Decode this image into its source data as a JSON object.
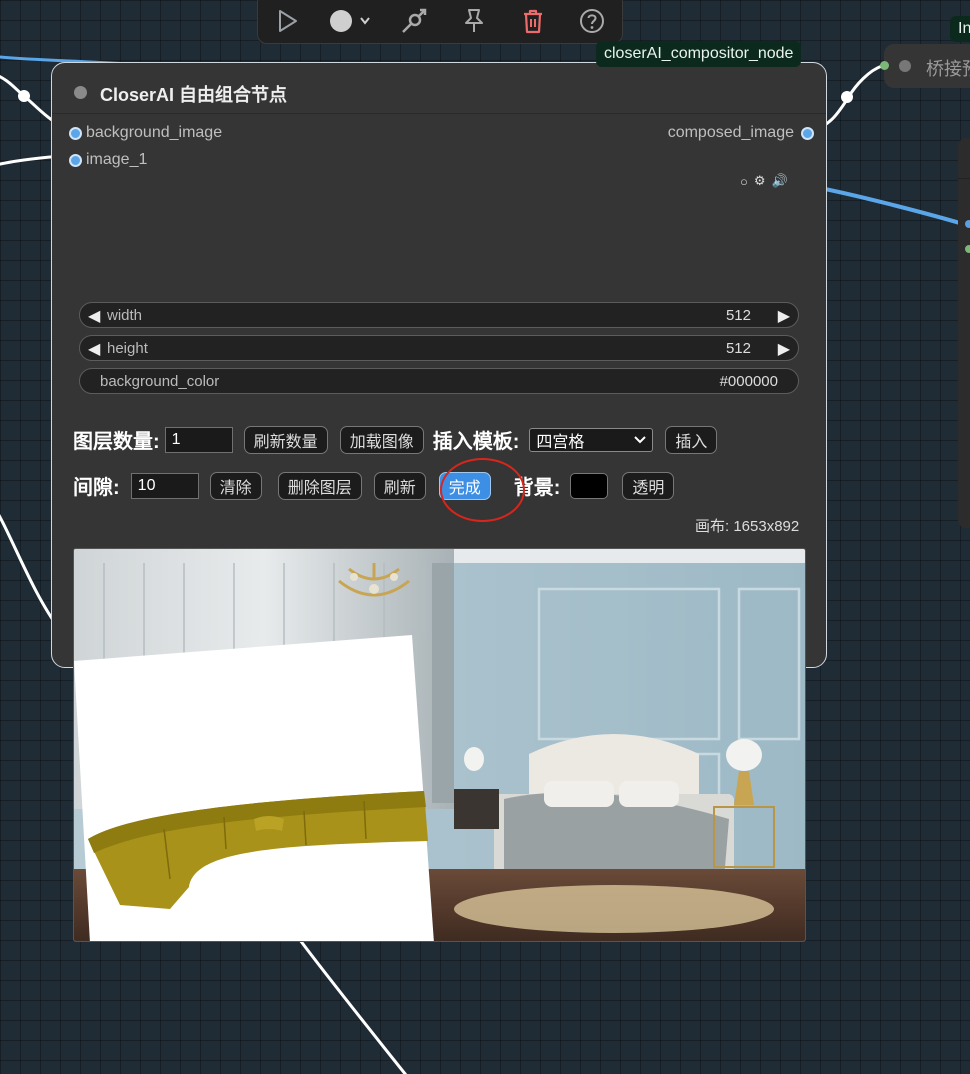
{
  "toolbar": {
    "buttons": [
      {
        "name": "run-icon"
      },
      {
        "name": "color-dot-icon"
      },
      {
        "name": "bypass-icon"
      },
      {
        "name": "pin-icon"
      },
      {
        "name": "delete-icon"
      },
      {
        "name": "help-icon"
      }
    ]
  },
  "node_badge": "closerAI_compositor_node",
  "right_badge": "In",
  "bridge_node": {
    "label": "桥接预"
  },
  "node": {
    "title": "CloserAI 自由组合节点",
    "inputs": [
      "background_image",
      "image_1"
    ],
    "output": "composed_image",
    "widgets": {
      "width": {
        "label": "width",
        "value": "512"
      },
      "height": {
        "label": "height",
        "value": "512"
      },
      "background_color": {
        "label": "background_color",
        "value": "#000000"
      }
    },
    "row1": {
      "layer_count_label": "图层数量:",
      "layer_count_value": "1",
      "refresh_count": "刷新数量",
      "load_image": "加载图像",
      "template_label": "插入模板:",
      "template_selected": "四宫格",
      "insert": "插入"
    },
    "row2": {
      "gap_label": "间隙:",
      "gap_value": "10",
      "clear": "清除",
      "delete_layer": "删除图层",
      "refresh": "刷新",
      "done": "完成",
      "bg_label": "背景:",
      "bg_color": "#000000",
      "transparent": "透明"
    },
    "canvas_info": "画布: 1653x892"
  },
  "colors": {
    "canvas_bg": "#1f2b35",
    "node_bg": "#353535",
    "accent": "#3d8fe6",
    "input_slot": "#5aa6e8",
    "highlight": "#d8261c"
  }
}
